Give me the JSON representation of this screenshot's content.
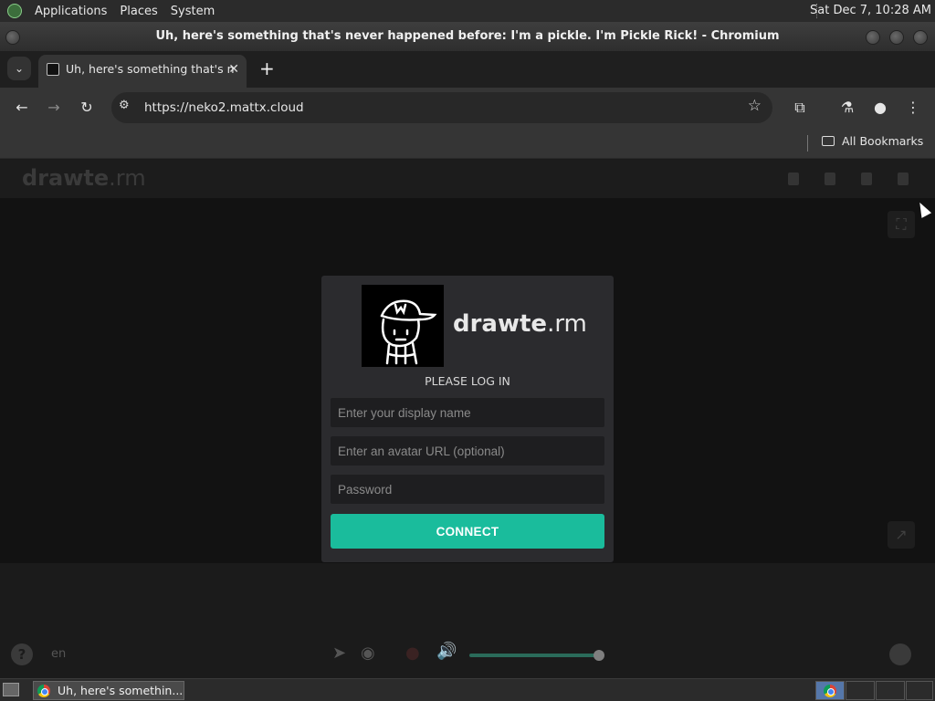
{
  "system_panel": {
    "menus": [
      "Applications",
      "Places",
      "System"
    ],
    "clock": "Sat Dec  7, 10:28 AM"
  },
  "window": {
    "title": "Uh, here's something that's never happened before: I'm a pickle. I'm Pickle Rick! - Chromium"
  },
  "browser": {
    "tab_title": "Uh, here's something that's n",
    "url": "https://neko2.mattx.cloud",
    "all_bookmarks": "All Bookmarks"
  },
  "neko": {
    "brand_bold": "drawte",
    "brand_thin": ".rm",
    "lang": "en"
  },
  "login": {
    "brand_bold": "drawte",
    "brand_thin": ".rm",
    "heading": "PLEASE LOG IN",
    "display_name_placeholder": "Enter your display name",
    "avatar_placeholder": "Enter an avatar URL (optional)",
    "password_placeholder": "Password",
    "connect_label": "CONNECT",
    "accent_color": "#1abc9c"
  },
  "taskbar": {
    "task_label": "Uh, here's somethin..."
  }
}
